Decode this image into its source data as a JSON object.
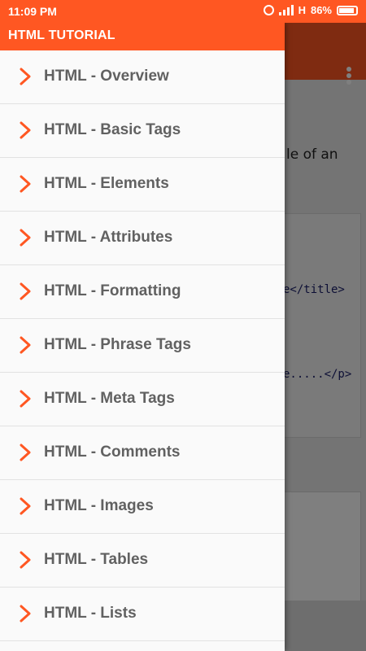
{
  "status_bar": {
    "time": "11:09 PM",
    "network": "H",
    "battery": "86%"
  },
  "drawer": {
    "title": "HTML TUTORIAL",
    "items": [
      {
        "label": "HTML - Overview"
      },
      {
        "label": "HTML - Basic Tags"
      },
      {
        "label": "HTML - Elements"
      },
      {
        "label": "HTML - Attributes"
      },
      {
        "label": "HTML - Formatting"
      },
      {
        "label": "HTML - Phrase Tags"
      },
      {
        "label": "HTML - Meta Tags"
      },
      {
        "label": "HTML - Comments"
      },
      {
        "label": "HTML - Images"
      },
      {
        "label": "HTML - Tables"
      },
      {
        "label": "HTML - Lists"
      }
    ]
  },
  "background": {
    "text_fragment": "le of an",
    "code_line_1": "e</title>",
    "code_line_2": "e.....</p>"
  },
  "colors": {
    "accent": "#ff5722",
    "chevron": "#ff5722",
    "item_text": "#616161"
  },
  "icons": {
    "overflow": "more-vert-icon",
    "item": "chevron-right-icon",
    "alarm": "alarm-icon",
    "signal": "signal-icon",
    "battery": "battery-icon"
  }
}
